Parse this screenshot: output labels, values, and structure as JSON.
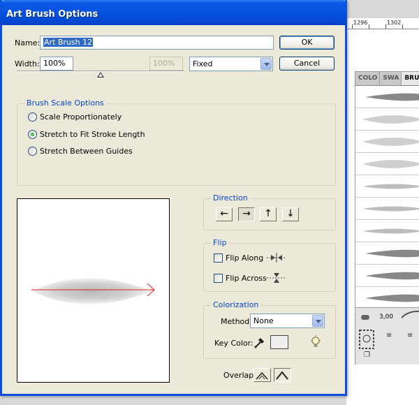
{
  "window": {
    "title": "Art Brush Options"
  },
  "name_field": {
    "label": "Name:",
    "value": "Art Brush 12"
  },
  "width_field": {
    "label": "Width:",
    "value": "100%",
    "disabled_value": "100%",
    "slider_level_percent": 50
  },
  "width_mode": {
    "selected": "Fixed"
  },
  "buttons": {
    "ok": "OK",
    "cancel": "Cancel"
  },
  "brush_scale": {
    "title": "Brush Scale Options",
    "options": [
      {
        "label": "Scale Proportionately",
        "checked": false
      },
      {
        "label": "Stretch to Fit Stroke Length",
        "checked": true
      },
      {
        "label": "Stretch Between Guides",
        "checked": false
      }
    ]
  },
  "direction": {
    "title": "Direction",
    "options": [
      "left",
      "right",
      "up",
      "down"
    ],
    "selected": "right",
    "glyphs": [
      "←",
      "→",
      "↑",
      "↓"
    ]
  },
  "flip": {
    "title": "Flip",
    "along_label": "Flip Along",
    "across_label": "Flip Across",
    "along_checked": false,
    "across_checked": false
  },
  "colorization": {
    "title": "Colorization",
    "method_label": "Method:",
    "method_value": "None",
    "key_color_label": "Key Color:",
    "key_color": "#eeeeee"
  },
  "overlap": {
    "label": "Overlap:",
    "selected": "second"
  },
  "background": {
    "ruler": {
      "mark1": "1296",
      "mark2": "1302"
    },
    "panel": {
      "tabs": [
        "COLO",
        "SWA",
        "BRUSH"
      ],
      "stroke_size": "3,00"
    }
  },
  "colors": {
    "accent": "#0a4ee2",
    "dialog_bg": "#ece9d8",
    "group_title": "#0046d5",
    "arrow": "#e02020"
  }
}
